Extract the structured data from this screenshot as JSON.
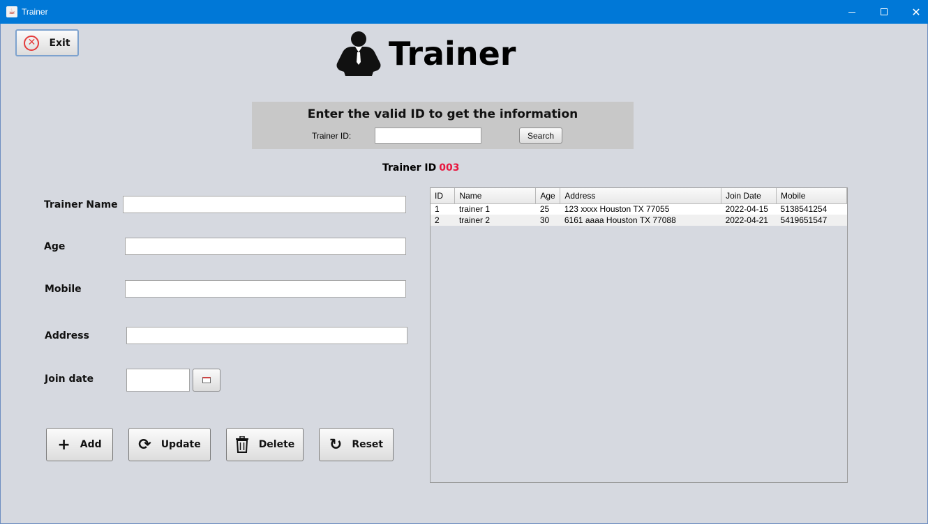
{
  "window": {
    "title": "Trainer"
  },
  "exit_label": "Exit",
  "page_title": "Trainer",
  "search": {
    "instruction": "Enter the valid ID to get the information",
    "id_label": "Trainer ID:",
    "id_value": "",
    "button_label": "Search"
  },
  "trainer_id": {
    "label": "Trainer ID",
    "value": "003"
  },
  "form": {
    "name_label": "Trainer Name",
    "age_label": "Age",
    "mobile_label": "Mobile",
    "address_label": "Address",
    "join_label": "Join date"
  },
  "actions": {
    "add": "Add",
    "update": "Update",
    "delete": "Delete",
    "reset": "Reset"
  },
  "table": {
    "columns": [
      "ID",
      "Name",
      "Age",
      "Address",
      "Join Date",
      "Mobile"
    ],
    "rows": [
      [
        "1",
        "trainer 1",
        "25",
        "123 xxxx Houston TX 77055",
        "2022-04-15",
        "5138541254"
      ],
      [
        "2",
        "trainer 2",
        "30",
        "6161 aaaa Houston TX 77088",
        "2022-04-21",
        "5419651547"
      ]
    ]
  },
  "colors": {
    "titlebar": "#0078d7",
    "id_value": "#e8173f",
    "exit_icon": "#e43b3b"
  },
  "icons": [
    "exit-icon",
    "trainer-icon",
    "calendar-icon",
    "plus-icon",
    "refresh-icon",
    "trash-icon",
    "reset-icon"
  ]
}
